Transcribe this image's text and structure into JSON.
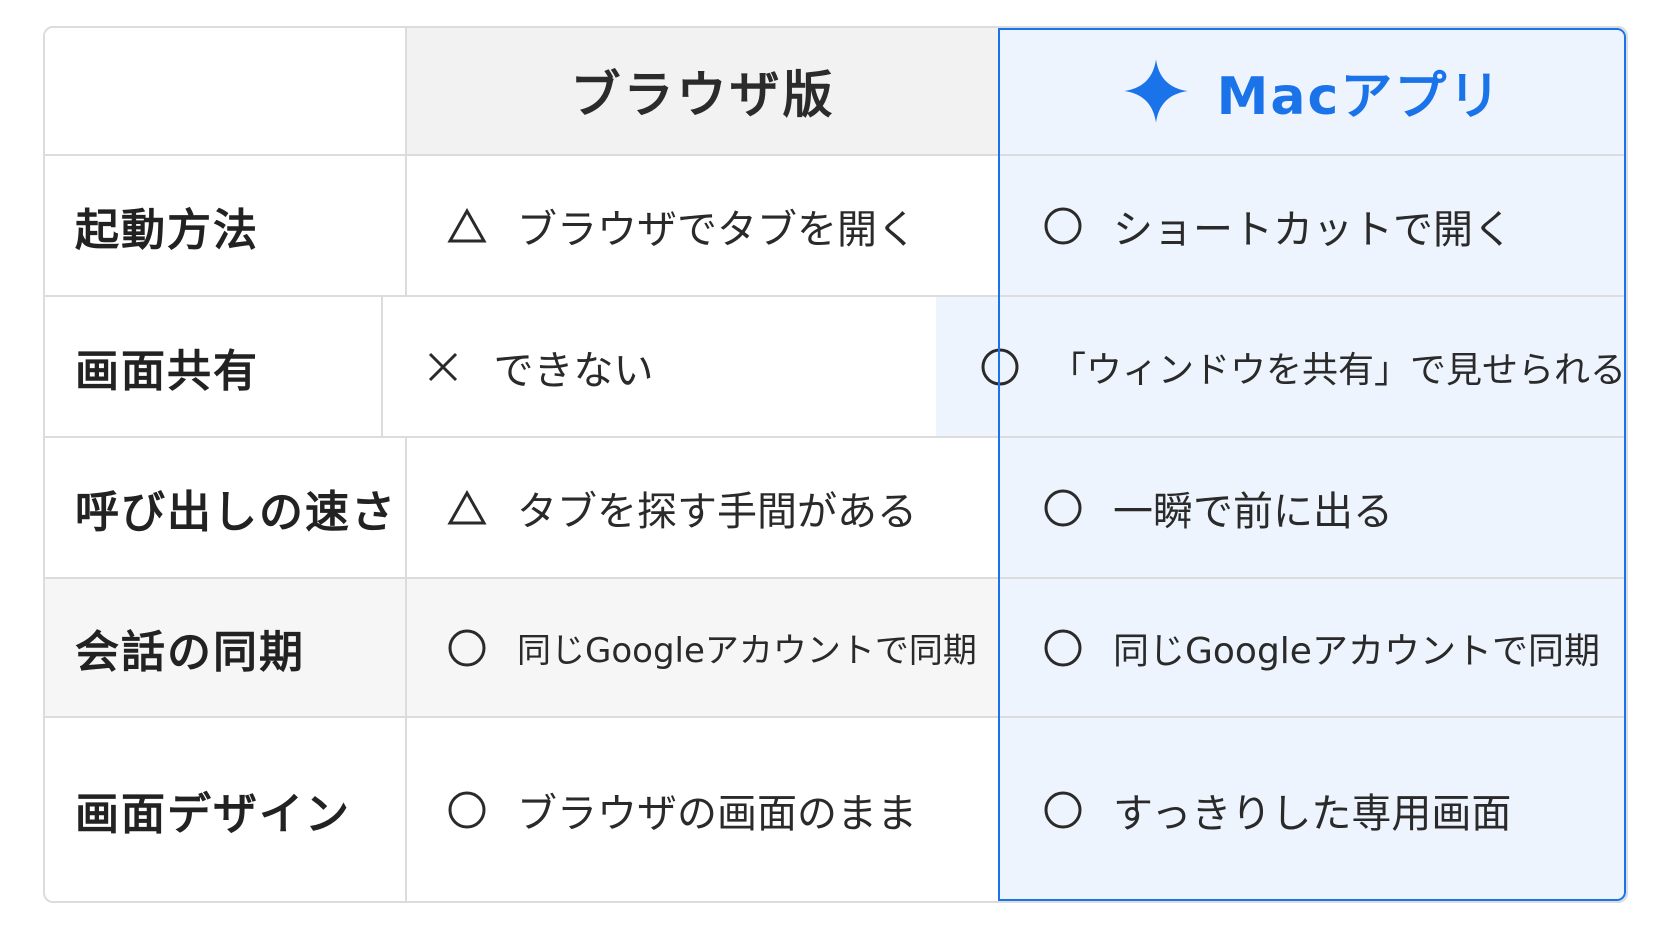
{
  "header": {
    "browser_label": "ブラウザ版",
    "mac_label": "Macアプリ",
    "mac_icon": "sparkle-icon",
    "accent_color": "#1a73e8"
  },
  "rows": [
    {
      "label": "起動方法",
      "browser": {
        "mark": "triangle",
        "text": "ブラウザでタブを開く"
      },
      "mac": {
        "mark": "circle",
        "text": "ショートカットで開く"
      }
    },
    {
      "label": "画面共有",
      "browser": {
        "mark": "cross",
        "text": "できない"
      },
      "mac": {
        "mark": "circle",
        "text": "「ウィンドウを共有」で見せられる"
      }
    },
    {
      "label": "呼び出しの速さ",
      "browser": {
        "mark": "triangle",
        "text": "タブを探す手間がある"
      },
      "mac": {
        "mark": "circle",
        "text": "一瞬で前に出る"
      }
    },
    {
      "label": "会話の同期",
      "browser": {
        "mark": "circle",
        "text": "同じGoogleアカウントで同期"
      },
      "mac": {
        "mark": "circle",
        "text": "同じGoogleアカウントで同期"
      }
    },
    {
      "label": "画面デザイン",
      "browser": {
        "mark": "circle",
        "text": "ブラウザの画面のまま"
      },
      "mac": {
        "mark": "circle",
        "text": "すっきりした専用画面"
      }
    }
  ]
}
